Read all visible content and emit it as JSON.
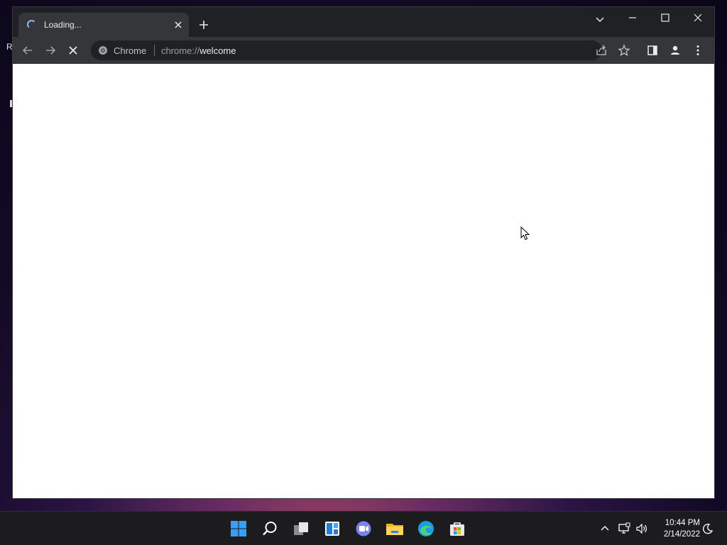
{
  "desktop": {
    "fragment": "R"
  },
  "browser": {
    "tab": {
      "title": "Loading...",
      "spinner_icon": "loading-spinner-icon",
      "close_icon": "close-icon"
    },
    "new_tab_icon": "plus-icon",
    "tab_search_icon": "chevron-down-icon",
    "window_controls": [
      "minimize-icon",
      "maximize-icon",
      "close-icon"
    ],
    "toolbar": {
      "back_icon": "arrow-left-icon",
      "forward_icon": "arrow-right-icon",
      "stop_icon": "close-icon",
      "site_chip_label": "Chrome",
      "url_scheme": "chrome://",
      "url_host": "welcome",
      "share_icon": "share-icon",
      "bookmark_icon": "star-icon",
      "side_panel_icon": "side-panel-icon",
      "profile_icon": "person-icon",
      "menu_icon": "more-vert-icon"
    }
  },
  "taskbar": {
    "apps": [
      "windows-start-icon",
      "search-icon",
      "task-view-icon",
      "widgets-icon",
      "chat-icon",
      "file-explorer-icon",
      "edge-icon",
      "store-icon"
    ],
    "tray": {
      "overflow_icon": "chevron-up-icon",
      "network_icon": "network-icon",
      "volume_icon": "volume-icon",
      "time": "10:44 PM",
      "date": "2/14/2022",
      "notification_icon": "moon-icon"
    }
  },
  "colors": {
    "frame": "#202124",
    "toolbar": "#35363a",
    "accent": "#8ab4f8",
    "start_blue": "#3a9ef5"
  }
}
